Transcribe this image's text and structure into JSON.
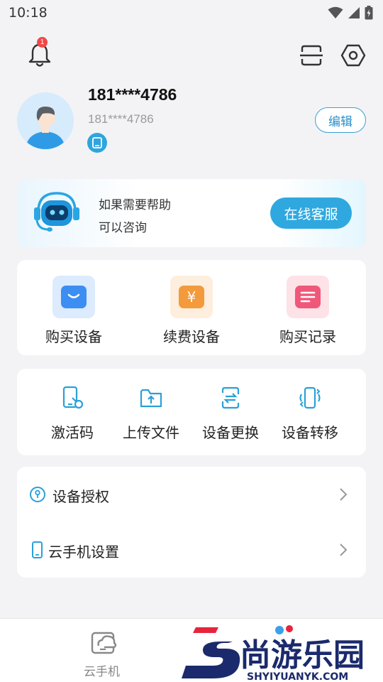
{
  "status_bar": {
    "time": "10:18"
  },
  "header": {
    "notification_count": "1"
  },
  "profile": {
    "name": "181****4786",
    "phone": "181****4786",
    "edit_label": "编辑"
  },
  "help_banner": {
    "line1": "如果需要帮助",
    "line2": "可以咨询",
    "button_label": "在线客服"
  },
  "purchase_tiles": [
    {
      "label": "购买设备",
      "icon": "device-cart-icon",
      "color": "#3d8ef2"
    },
    {
      "label": "续费设备",
      "icon": "yuan-renew-icon",
      "color": "#f39a3c",
      "glyph": "¥"
    },
    {
      "label": "购买记录",
      "icon": "record-list-icon",
      "color": "#f0587a"
    }
  ],
  "tools": [
    {
      "label": "激活码",
      "icon": "activation-code-icon"
    },
    {
      "label": "上传文件",
      "icon": "upload-folder-icon"
    },
    {
      "label": "设备更换",
      "icon": "device-swap-icon"
    },
    {
      "label": "设备转移",
      "icon": "device-transfer-icon"
    }
  ],
  "settings_list": [
    {
      "label": "设备授权",
      "icon": "authorization-icon"
    },
    {
      "label": "云手机设置",
      "icon": "cloud-phone-settings-icon"
    }
  ],
  "bottom_nav": {
    "items": [
      {
        "label": "云手机",
        "icon": "cloud-phone-icon"
      }
    ]
  },
  "watermark": {
    "brand": "尚游乐园",
    "domain": "SHYIYUANYK.COM",
    "colors": {
      "navy": "#1a2a6c",
      "red": "#e8243c"
    }
  },
  "colors": {
    "accent": "#2fa8e0",
    "icon_blue": "#2aa0d8",
    "badge_red": "#f04848"
  }
}
